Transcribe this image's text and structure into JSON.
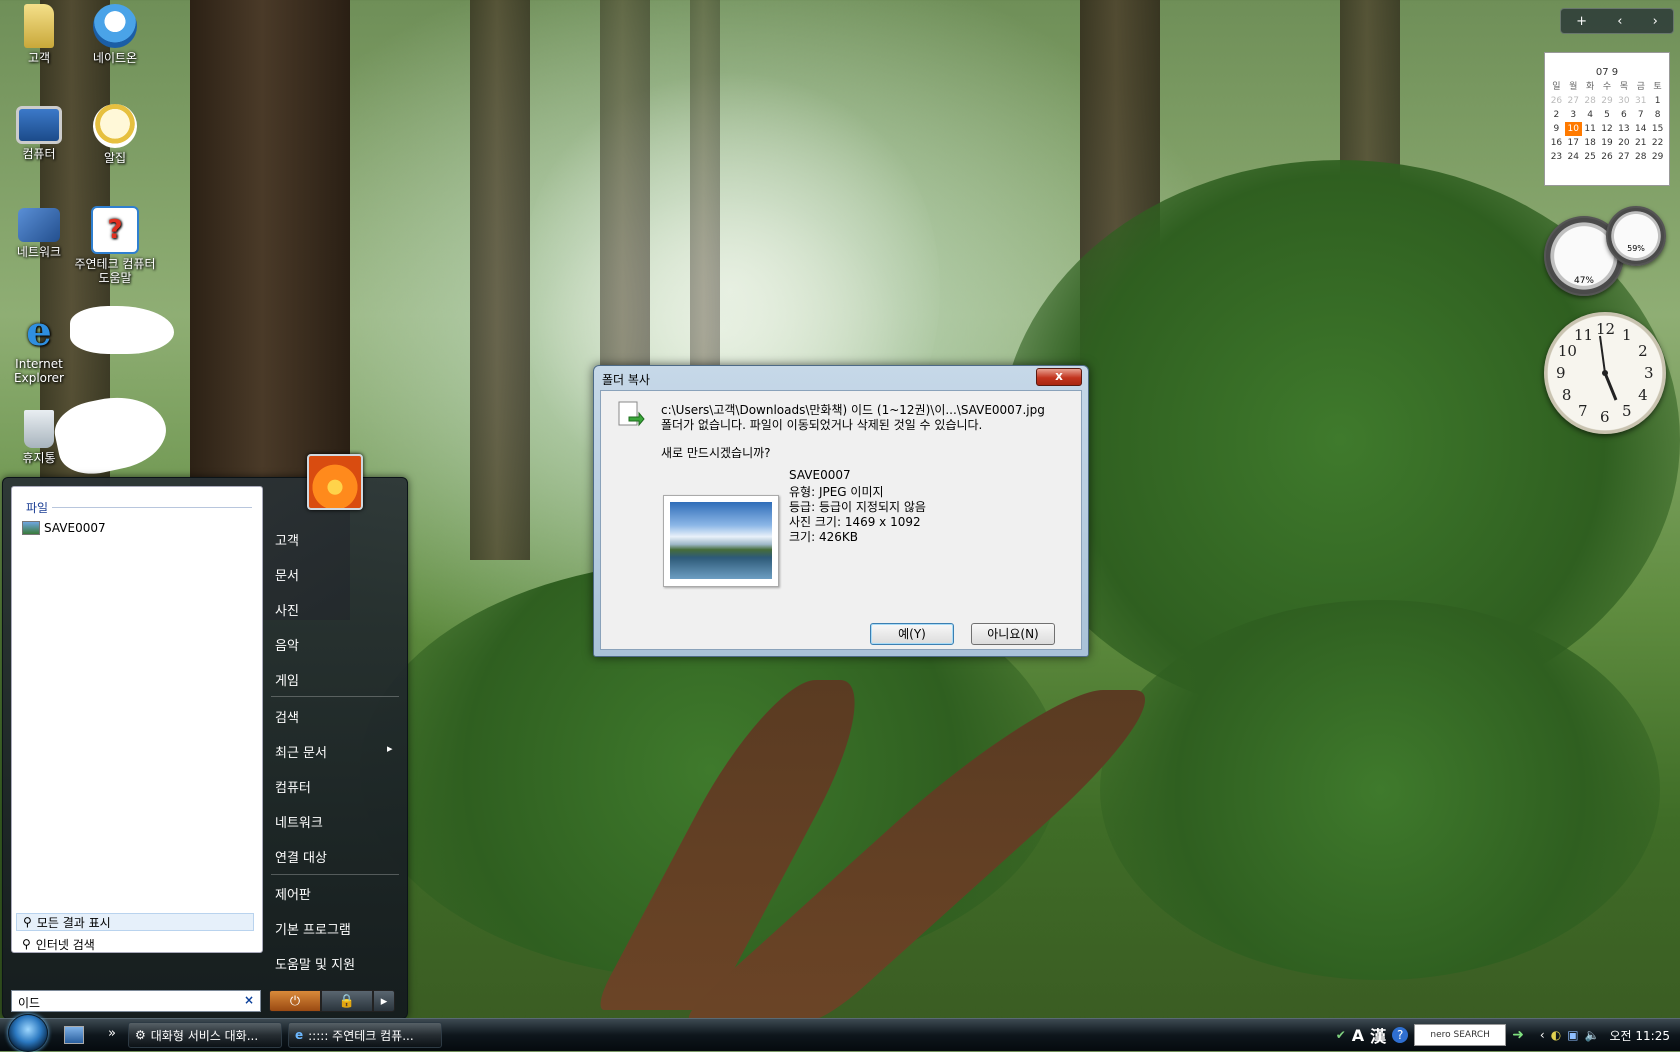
{
  "desktop_icons": [
    {
      "label": "고객",
      "icon": "folder-icon"
    },
    {
      "label": "네이트온",
      "icon": "nateon-icon"
    },
    {
      "label": "컴퓨터",
      "icon": "computer-icon"
    },
    {
      "label": "알집",
      "icon": "alzip-icon"
    },
    {
      "label": "네트워크",
      "icon": "network-icon"
    },
    {
      "label": "주연테크 컴퓨터도움말",
      "icon": "help-icon"
    },
    {
      "label": "Internet Explorer",
      "icon": "ie-icon"
    },
    {
      "label": "휴지통",
      "icon": "recycle-bin-icon"
    }
  ],
  "start_menu": {
    "left_section_title": "파일",
    "results": [
      {
        "label": "SAVE0007",
        "icon": "image-file-icon"
      }
    ],
    "show_all_results": "모든 결과 표시",
    "internet_search": "인터넷 검색",
    "search_value": "이드",
    "search_clear": "×",
    "right_items": [
      "고객",
      "문서",
      "사진",
      "음악",
      "게임",
      "검색",
      "최근 문서",
      "컴퓨터",
      "네트워크",
      "연결 대상",
      "제어판",
      "기본 프로그램",
      "도움말 및 지원"
    ],
    "recent_docs_arrow": "▸",
    "power_icons": {
      "power": "⏻",
      "lock": "🔒",
      "more": "▸"
    }
  },
  "dialog": {
    "title": "폴더 복사",
    "close": "x",
    "path_line": "c:\\Users\\고객\\Downloads\\만화책)  이드 (1~12권)\\이...\\SAVE0007.jpg",
    "message_line": "폴더가 없습니다. 파일이 이동되었거나 삭제된 것일 수 있습니다.",
    "question": "새로 만드시겠습니까?",
    "file_name": "SAVE0007",
    "file_type": "유형: JPEG 이미지",
    "file_rating": "등급: 등급이 지정되지 않음",
    "file_dimensions": "사진 크기: 1469 x 1092",
    "file_size": "크기: 426KB",
    "yes_button": "예(Y)",
    "no_button": "아니요(N)"
  },
  "taskbar": {
    "quick_launch_more": "»",
    "tasks": [
      {
        "label": "대화형 서비스 대화..."
      },
      {
        "label": "::::: 주연테크 컴퓨..."
      }
    ],
    "tray": {
      "ime_a": "A",
      "ime_han": "漢",
      "help": "?",
      "nero": "nero SEARCH",
      "arrow": "➜",
      "chevron": "‹",
      "clock": "오전 11:25"
    }
  },
  "sidebar": {
    "toolbar_add": "+",
    "toolbar_prev": "‹",
    "toolbar_next": "›",
    "calendar_header": "07 9",
    "weekday_labels": [
      "일",
      "월",
      "화",
      "수",
      "목",
      "금",
      "토"
    ],
    "calendar_days": [
      "26",
      "27",
      "28",
      "29",
      "30",
      "31",
      "1",
      "2",
      "3",
      "4",
      "5",
      "6",
      "7",
      "8",
      "9",
      "10",
      "11",
      "12",
      "13",
      "14",
      "15",
      "16",
      "17",
      "18",
      "19",
      "20",
      "21",
      "22",
      "23",
      "24",
      "25",
      "26",
      "27",
      "28",
      "29"
    ],
    "today": "10",
    "cpu_percent": "47%",
    "mem_percent": "59%",
    "clock_numbers": [
      "12",
      "1",
      "2",
      "3",
      "4",
      "5",
      "6",
      "7",
      "8",
      "9",
      "10",
      "11"
    ]
  },
  "colors": {
    "accent": "#1c3f95",
    "today": "#ff7a00",
    "close": "#c2341e"
  }
}
